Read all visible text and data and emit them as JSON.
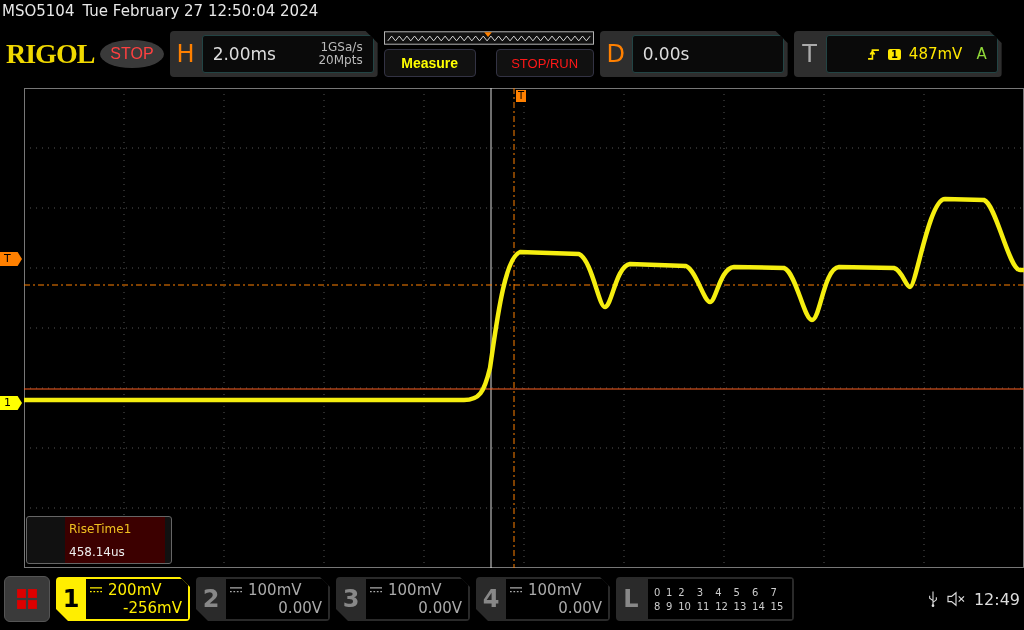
{
  "status_line": {
    "model": "MSO5104",
    "datetime": "Tue February 27 12:50:04 2024"
  },
  "toolbar": {
    "logo": "RIGOL",
    "run_state": "STOP",
    "horizontal": {
      "label": "H",
      "timebase": "2.00ms",
      "sample_rate": "1GSa/s",
      "memory_depth": "20Mpts"
    },
    "buttons": [
      "Measure",
      "STOP/RUN"
    ],
    "delay": {
      "label": "D",
      "value": "0.00s"
    },
    "trigger": {
      "label": "T",
      "channel": "1",
      "level": "487mV",
      "mode": "A"
    }
  },
  "display": {
    "trigger_level_marker": "T",
    "trigger_position_marker": "T",
    "channel_marker": "1",
    "measurement": {
      "name": "RiseTime1",
      "value": "458.14us"
    }
  },
  "channels": [
    {
      "number": "1",
      "scale": "200mV",
      "offset": "-256mV",
      "selected": true
    },
    {
      "number": "2",
      "scale": "100mV",
      "offset": "0.00V",
      "selected": false
    },
    {
      "number": "3",
      "scale": "100mV",
      "offset": "0.00V",
      "selected": false
    },
    {
      "number": "4",
      "scale": "100mV",
      "offset": "0.00V",
      "selected": false
    }
  ],
  "logic": {
    "label": "L",
    "bits": [
      "0",
      "1",
      "2",
      "3",
      "4",
      "5",
      "6",
      "7",
      "8",
      "9",
      "10",
      "11",
      "12",
      "13",
      "14",
      "15"
    ]
  },
  "system_tray": {
    "time": "12:49"
  }
}
